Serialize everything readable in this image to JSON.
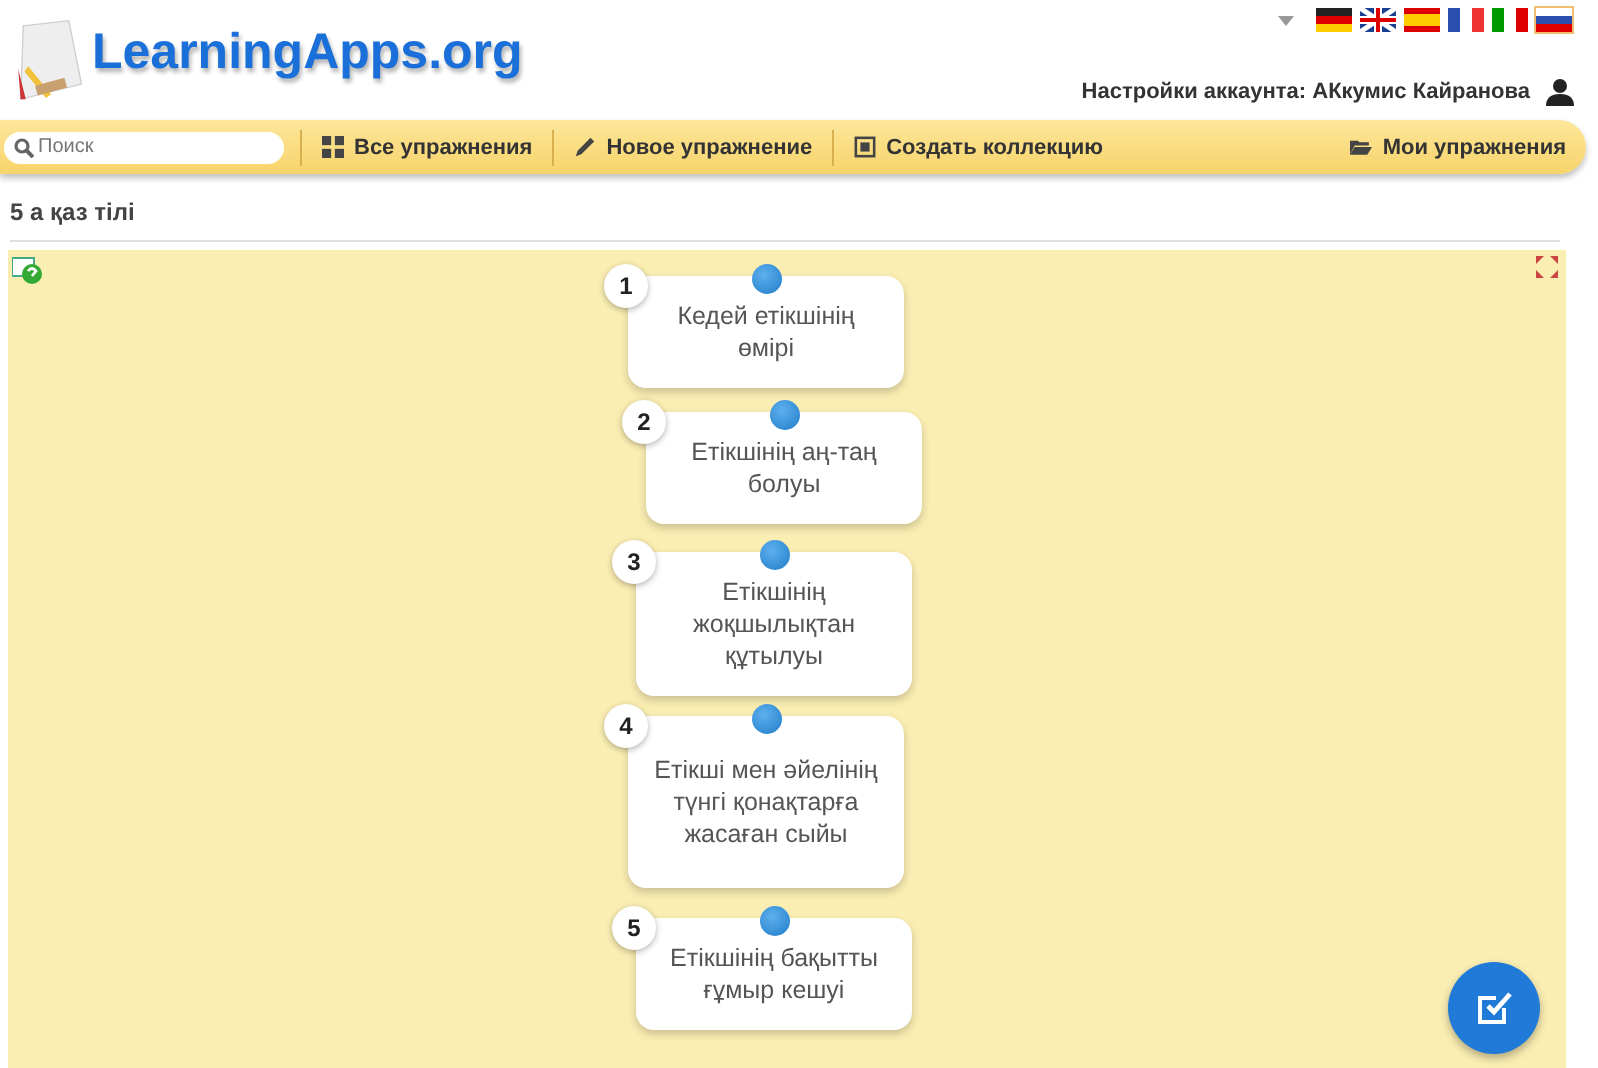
{
  "header": {
    "logo": "LearningApps.org",
    "account_label": "Настройки аккаунта: АКкумис Кайранова"
  },
  "languages": [
    {
      "kind": "de",
      "selected": false
    },
    {
      "kind": "gb",
      "selected": false
    },
    {
      "kind": "es",
      "selected": false
    },
    {
      "kind": "fr",
      "selected": false
    },
    {
      "kind": "it",
      "selected": false
    },
    {
      "kind": "ru",
      "selected": true
    }
  ],
  "nav": {
    "search": {
      "placeholder": "Поиск"
    },
    "items": [
      {
        "kind": "grid",
        "label": "Все упражнения"
      },
      {
        "kind": "pencil",
        "label": "Новое упражнение"
      },
      {
        "kind": "collection",
        "label": "Создать коллекцию"
      },
      {
        "kind": "folder",
        "label": "Мои упражнения"
      }
    ]
  },
  "page_title": "5 а қаз тілі",
  "cards": [
    {
      "number": "1",
      "text": "Кедей етікшінің өмірі"
    },
    {
      "number": "2",
      "text": "Етікшінің аң-таң болуы"
    },
    {
      "number": "3",
      "text": "Етікшінің жоқшылықтан құтылуы"
    },
    {
      "number": "4",
      "text": "Етікші мен әйелінің түнгі қонақтарға жасаған сыйы"
    },
    {
      "number": "5",
      "text": "Етікшінің бақытты ғұмыр кешуі"
    }
  ]
}
